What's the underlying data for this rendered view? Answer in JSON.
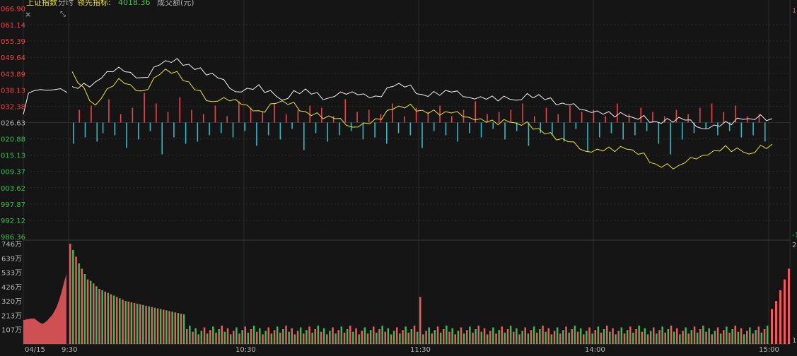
{
  "header": {
    "index_name": "上证指数",
    "mode_label": "分时",
    "indicator_label": "领先指标:",
    "indicator_value": "4018.36",
    "volume_label": "成交额(元)"
  },
  "colors": {
    "background": "#151515",
    "grid": "#2c2c2c",
    "up": "#e8464a",
    "down": "#2bbcc8",
    "vol_up": "#ee5a5e",
    "vol_down": "#3cba54",
    "price_line": "#f0f0f0",
    "lead_line": "#e6e62a",
    "label_gray": "#b4b4b4",
    "header_yellow": "#e6dc32",
    "header_green": "#3cd23c"
  },
  "chart_data": [
    {
      "type": "line",
      "title": "",
      "ylim": [
        3986.36,
        4066.9
      ],
      "reference": 4026.63,
      "y_ticks": [
        "066.90",
        "061.14",
        "055.39",
        "049.64",
        "043.89",
        "038.13",
        "032.38",
        "026.63",
        "020.88",
        "015.13",
        "009.37",
        "003.62",
        "997.87",
        "992.12",
        "986.36"
      ],
      "right_ticks_top": "1",
      "right_ticks_bottom": "-1",
      "premarket_x": [
        0,
        0.03,
        0.06,
        0.1,
        0.14,
        0.18,
        0.22,
        0.26
      ],
      "premarket_y": [
        4029.5,
        4037.0,
        4037.8,
        4038.3,
        4038.0,
        4038.2,
        4038.6,
        4037.2
      ],
      "x": [
        0,
        8,
        16,
        24,
        32,
        40,
        48,
        56,
        64,
        72,
        80,
        88,
        96,
        104,
        112,
        120,
        128,
        136,
        144,
        152,
        160,
        168,
        176,
        184,
        192,
        200,
        208,
        216,
        224,
        232,
        240
      ],
      "series": [
        {
          "key": "price",
          "values": [
            4039.3,
            4041.0,
            4046.2,
            4042.5,
            4048.5,
            4047.2,
            4044.0,
            4037.5,
            4040.0,
            4034.5,
            4038.5,
            4035.3,
            4037.5,
            4036.0,
            4040.5,
            4036.5,
            4038.0,
            4035.5,
            4036.0,
            4034.5,
            4036.5,
            4033.5,
            4031.0,
            4030.5,
            4028.5,
            4027.0,
            4028.5,
            4024.5,
            4027.0,
            4028.0,
            4028.0
          ]
        },
        {
          "key": "lead",
          "values": [
            4044.6,
            4032.8,
            4042.2,
            4037.8,
            4045.5,
            4041.0,
            4034.0,
            4034.8,
            4030.8,
            4034.3,
            4030.5,
            4029.0,
            4025.0,
            4028.0,
            4032.5,
            4031.0,
            4030.5,
            4028.5,
            4027.5,
            4026.5,
            4024.5,
            4021.0,
            4016.5,
            4018.0,
            4017.0,
            4012.0,
            4011.5,
            4015.0,
            4018.5,
            4015.5,
            4019.0
          ]
        }
      ],
      "diff_bars": [
        -10,
        6,
        -7,
        8,
        -9,
        -5,
        11,
        -6,
        4,
        -12,
        7,
        -8,
        14,
        -4,
        9,
        -15,
        5,
        -7,
        12,
        -10,
        6,
        -9,
        4,
        -6,
        8,
        -5,
        3,
        -7,
        10,
        -4,
        7,
        -11,
        5,
        -6,
        9,
        -8,
        4,
        -3,
        6,
        -13,
        8,
        -5,
        7,
        -9,
        3,
        -6,
        11,
        -4,
        5,
        -8,
        6,
        -7,
        4,
        -10,
        9,
        -5,
        3,
        -6,
        7,
        -12,
        5,
        -4,
        8,
        -6,
        3,
        -9,
        6,
        -5,
        10,
        -7,
        4,
        -3,
        5,
        -8,
        6,
        -4,
        9,
        -11,
        3,
        -5,
        7,
        -6,
        4,
        -9,
        8,
        -3,
        5,
        -14,
        6,
        -7,
        3,
        -5,
        9,
        -8,
        4,
        -6,
        7,
        -4,
        5,
        -10,
        3,
        -15,
        6,
        -8,
        4,
        -5,
        7,
        -3,
        9,
        -6,
        5,
        -4,
        8,
        -7,
        3,
        -6,
        4,
        -9
      ]
    },
    {
      "type": "bar",
      "title": "",
      "ylim": [
        0,
        746
      ],
      "y_ticks": [
        "746万",
        "639万",
        "533万",
        "426万",
        "320万",
        "213万",
        "107万"
      ],
      "right_ticks_top": "2",
      "right_ticks_bottom": "1",
      "x_ticks": [
        "04/15",
        "9:30",
        "10:30",
        "11:30",
        "14:00",
        "15:00"
      ],
      "premarket_values": [
        178,
        182,
        185,
        188,
        190,
        185,
        170,
        158,
        150,
        160,
        175,
        195,
        215,
        245,
        280,
        330,
        390,
        460,
        520
      ],
      "values_head": [
        746,
        700,
        650,
        600,
        560,
        520,
        480,
        470,
        450,
        430,
        410,
        400,
        390,
        380,
        370,
        360,
        350,
        340,
        330,
        320,
        315,
        310,
        305,
        300,
        295,
        290,
        285,
        280,
        275,
        270,
        265,
        260,
        255,
        250,
        245,
        240,
        235,
        230,
        225,
        220
      ],
      "base_level": 130,
      "spike_1130": 350,
      "tail_values": [
        260,
        320,
        400,
        480,
        560
      ],
      "pattern": "ud"
    }
  ]
}
